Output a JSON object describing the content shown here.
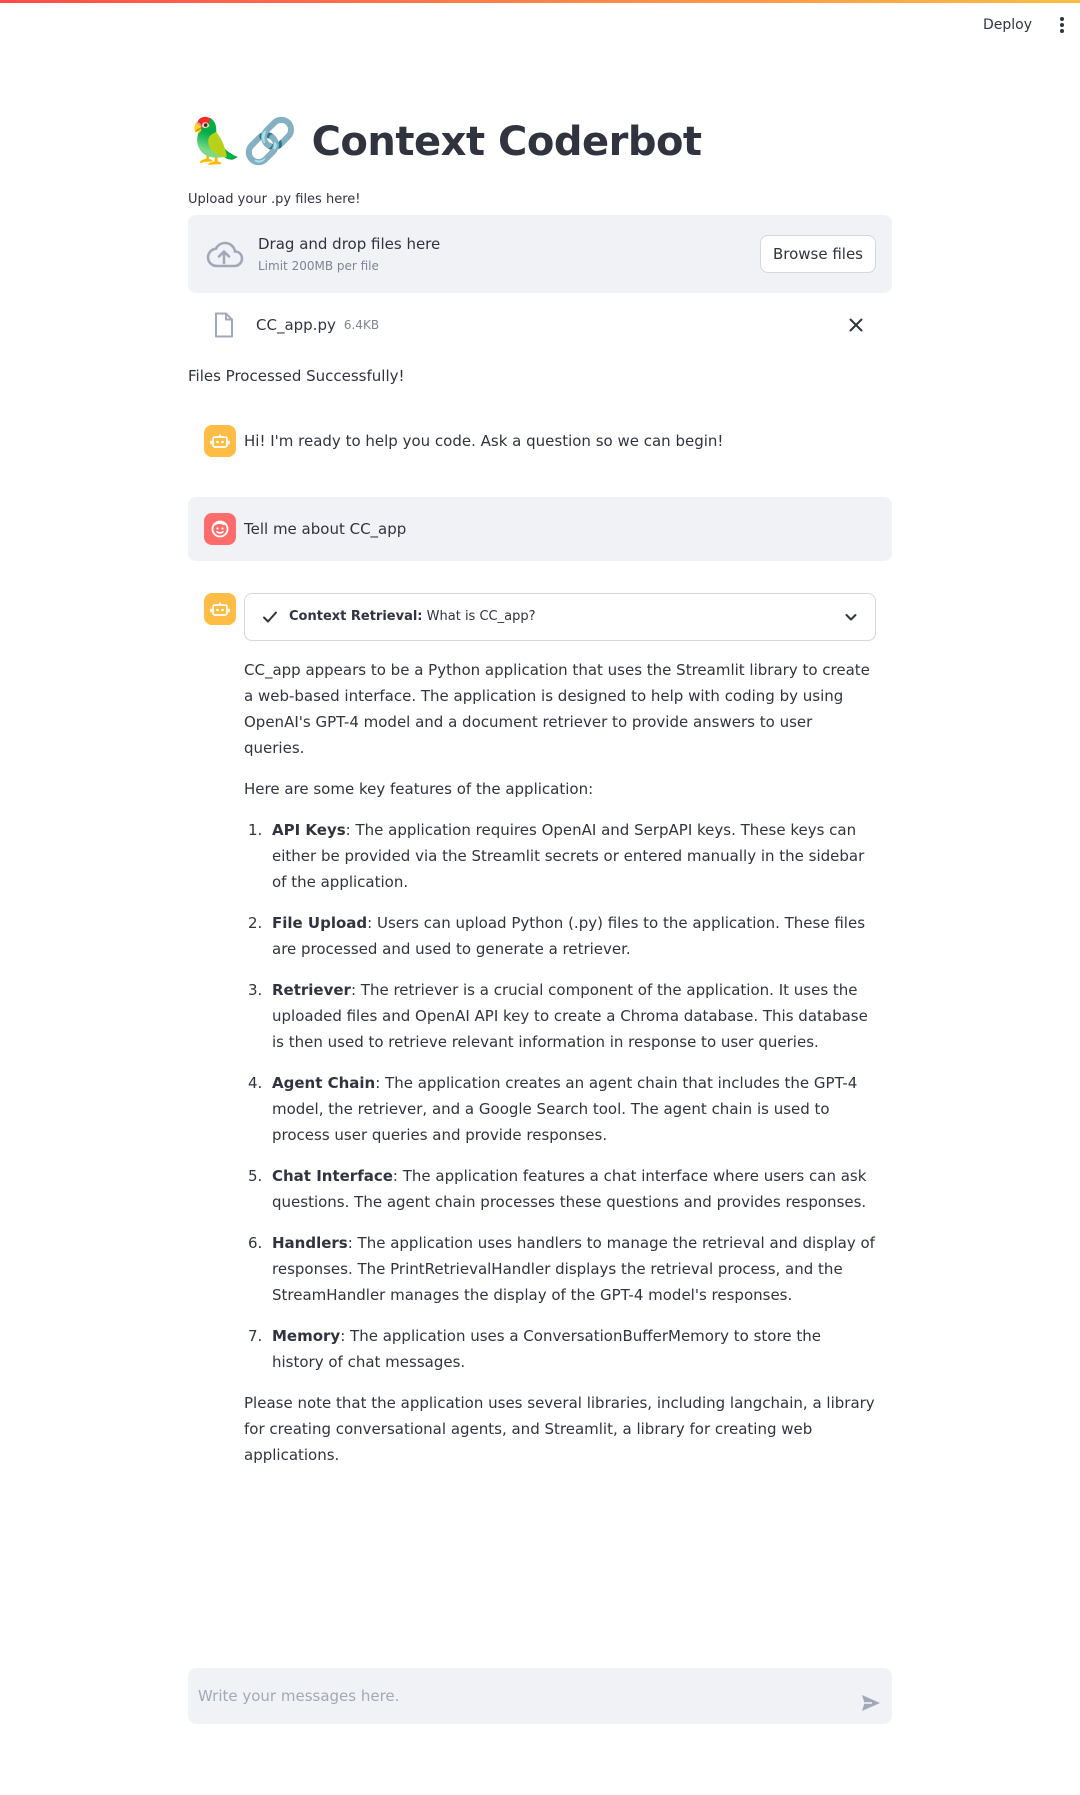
{
  "header": {
    "deploy_label": "Deploy",
    "menu_icon": "more-vertical-icon"
  },
  "title": {
    "emoji": "🦜🔗",
    "text": "Context Coderbot"
  },
  "uploader": {
    "label": "Upload your .py files here!",
    "drop_title": "Drag and drop files here",
    "drop_sub": "Limit 200MB per file",
    "browse_label": "Browse files",
    "file": {
      "name": "CC_app.py",
      "size": "6.4KB"
    }
  },
  "status": "Files Processed Successfully!",
  "messages": {
    "greeting": "Hi! I'm ready to help you code. Ask a question so we can begin!",
    "user": "Tell me about CC_app",
    "expander": {
      "label": "Context Retrieval:",
      "query": "What is CC_app?"
    },
    "answer": {
      "intro": "CC_app appears to be a Python application that uses the Streamlit library to create a web-based interface. The application is designed to help with coding by using OpenAI's GPT-4 model and a document retriever to provide answers to user queries.",
      "lead": "Here are some key features of the application:",
      "features": [
        {
          "num": "1.",
          "title": "API Keys",
          "text": ": The application requires OpenAI and SerpAPI keys. These keys can either be provided via the Streamlit secrets or entered manually in the sidebar of the application."
        },
        {
          "num": "2.",
          "title": "File Upload",
          "text": ": Users can upload Python (.py) files to the application. These files are processed and used to generate a retriever."
        },
        {
          "num": "3.",
          "title": "Retriever",
          "text": ": The retriever is a crucial component of the application. It uses the uploaded files and OpenAI API key to create a Chroma database. This database is then used to retrieve relevant information in response to user queries."
        },
        {
          "num": "4.",
          "title": "Agent Chain",
          "text": ": The application creates an agent chain that includes the GPT-4 model, the retriever, and a Google Search tool. The agent chain is used to process user queries and provide responses."
        },
        {
          "num": "5.",
          "title": "Chat Interface",
          "text": ": The application features a chat interface where users can ask questions. The agent chain processes these questions and provides responses."
        },
        {
          "num": "6.",
          "title": "Handlers",
          "text": ": The application uses handlers to manage the retrieval and display of responses. The PrintRetrievalHandler displays the retrieval process, and the StreamHandler manages the display of the GPT-4 model's responses."
        },
        {
          "num": "7.",
          "title": "Memory",
          "text": ": The application uses a ConversationBufferMemory to store the history of chat messages."
        }
      ],
      "outro": "Please note that the application uses several libraries, including langchain, a library for creating conversational agents, and Streamlit, a library for creating web applications."
    }
  },
  "chat_input": {
    "placeholder": "Write your messages here."
  },
  "colors": {
    "accent_red": "#ff4b4b",
    "accent_yellow": "#ffbd45",
    "bot_avatar": "#ffbd45",
    "user_avatar": "#ff6c6c",
    "panel_bg": "#f0f2f6"
  }
}
